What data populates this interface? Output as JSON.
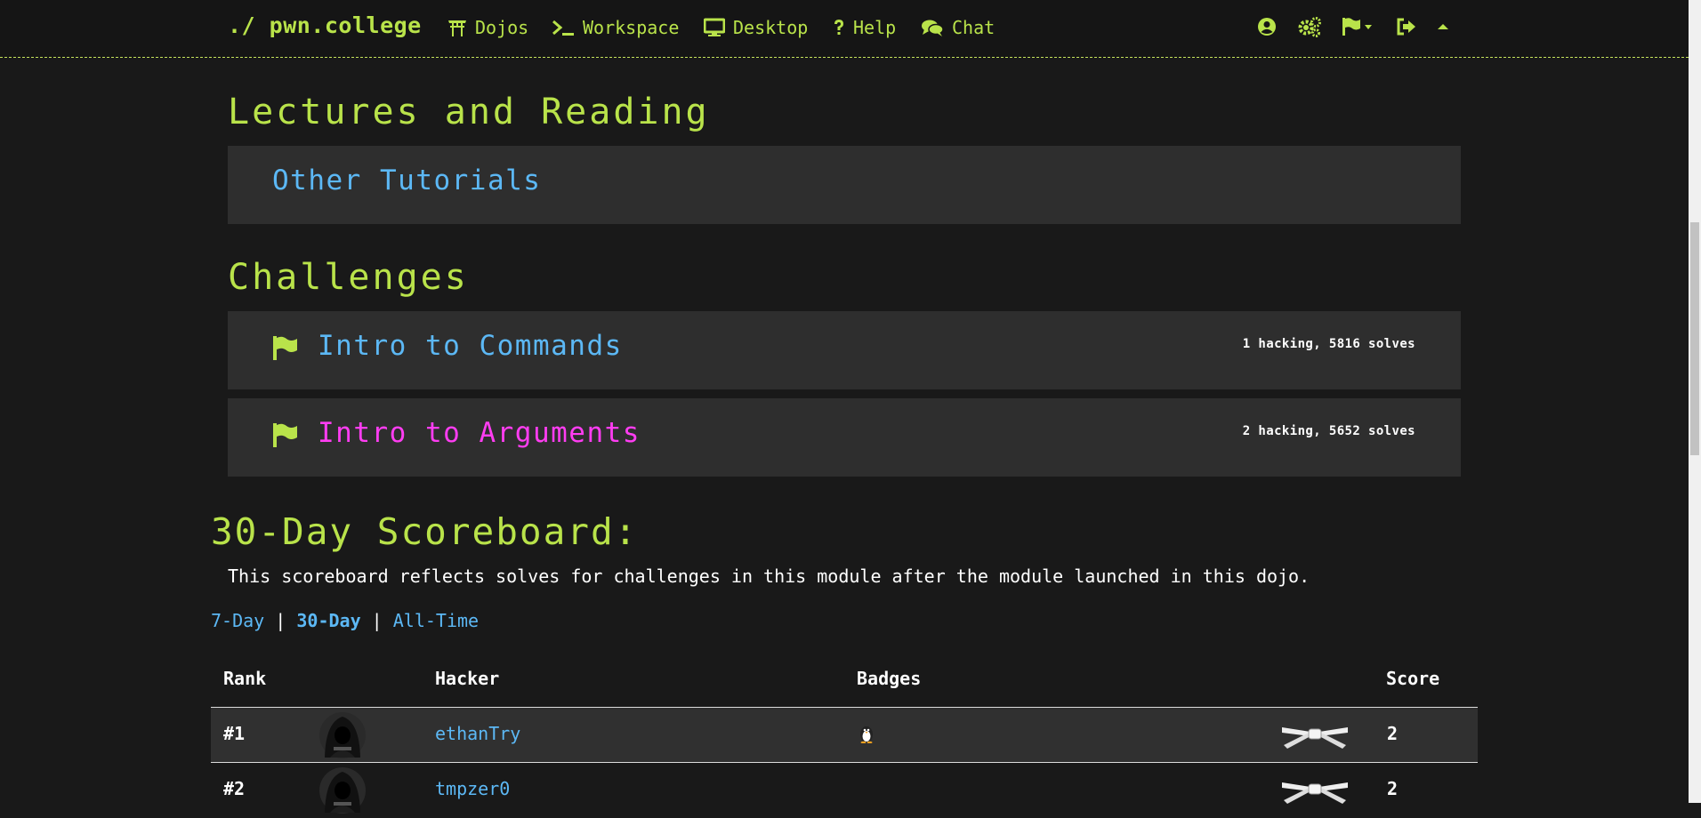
{
  "nav": {
    "brand": "./ pwn.college",
    "links": [
      {
        "label": "Dojos",
        "icon": "torii-gate-icon"
      },
      {
        "label": "Workspace",
        "icon": "terminal-icon"
      },
      {
        "label": "Desktop",
        "icon": "desktop-icon"
      },
      {
        "label": "Help",
        "icon": "question-icon"
      },
      {
        "label": "Chat",
        "icon": "comments-icon"
      }
    ],
    "right_icons": [
      "user-circle-icon",
      "cogs-icon",
      "flag-dropdown-icon",
      "sign-out-icon",
      "caret-up-icon"
    ]
  },
  "lectures": {
    "title": "Lectures and Reading",
    "items": [
      {
        "label": "Other Tutorials"
      }
    ]
  },
  "challenges": {
    "title": "Challenges",
    "items": [
      {
        "label": "Intro to Commands",
        "stats": "1 hacking, 5816 solves",
        "color": "#5cb8f5"
      },
      {
        "label": "Intro to Arguments",
        "stats": "2 hacking, 5652 solves",
        "color": "#ff3df2"
      }
    ]
  },
  "scoreboard": {
    "title": "30-Day Scoreboard:",
    "description": "This scoreboard reflects solves for challenges in this module after the module launched in this dojo.",
    "tabs": [
      {
        "label": "7-Day",
        "active": false
      },
      {
        "label": "30-Day",
        "active": true
      },
      {
        "label": "All-Time",
        "active": false
      }
    ],
    "separator": "|",
    "columns": {
      "rank": "Rank",
      "hacker": "Hacker",
      "badges": "Badges",
      "score": "Score"
    },
    "rows": [
      {
        "rank": "#1",
        "hacker": "ethanTry",
        "badge": "penguin-icon",
        "belt": "white-belt-icon",
        "score": "2"
      },
      {
        "rank": "#2",
        "hacker": "tmpzer0",
        "badge": "",
        "belt": "white-belt-icon",
        "score": "2"
      }
    ]
  },
  "colors": {
    "accent_green": "#b9e34a",
    "link_blue": "#5cb8f5",
    "highlight_magenta": "#ff3df2",
    "background": "#191919",
    "card": "#2e2e2e"
  }
}
